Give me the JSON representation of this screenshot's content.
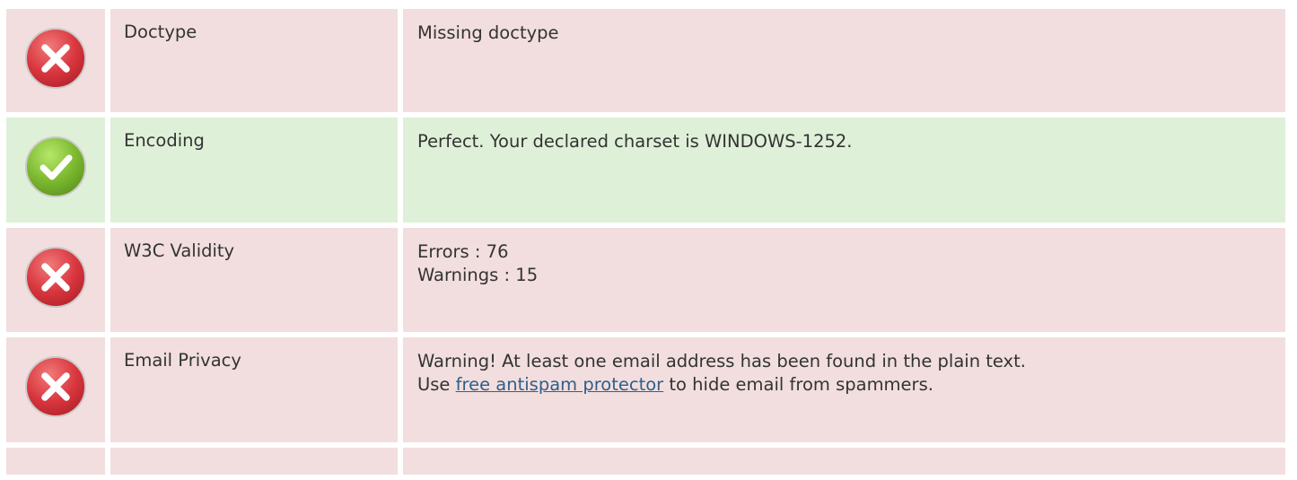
{
  "rows": [
    {
      "status": "error",
      "icon": "error-x-icon",
      "label": "Doctype",
      "lines": [
        "Missing doctype"
      ]
    },
    {
      "status": "ok",
      "icon": "success-check-icon",
      "label": "Encoding",
      "lines": [
        "Perfect. Your declared charset is WINDOWS-1252."
      ]
    },
    {
      "status": "error",
      "icon": "error-x-icon",
      "label": "W3C Validity",
      "lines": [
        "Errors : 76",
        "Warnings : 15"
      ]
    },
    {
      "status": "error",
      "icon": "error-x-icon",
      "label": "Email Privacy",
      "line1": "Warning! At least one email address has been found in the plain text.",
      "line2_prefix": "Use ",
      "link_text": "free antispam protector",
      "line2_suffix": " to hide email from spammers."
    }
  ],
  "colors": {
    "error_bg": "#f2dede",
    "ok_bg": "#dff0d8",
    "error_icon": "#d9363e",
    "ok_icon": "#7cb82f",
    "link": "#2f5f8a"
  }
}
